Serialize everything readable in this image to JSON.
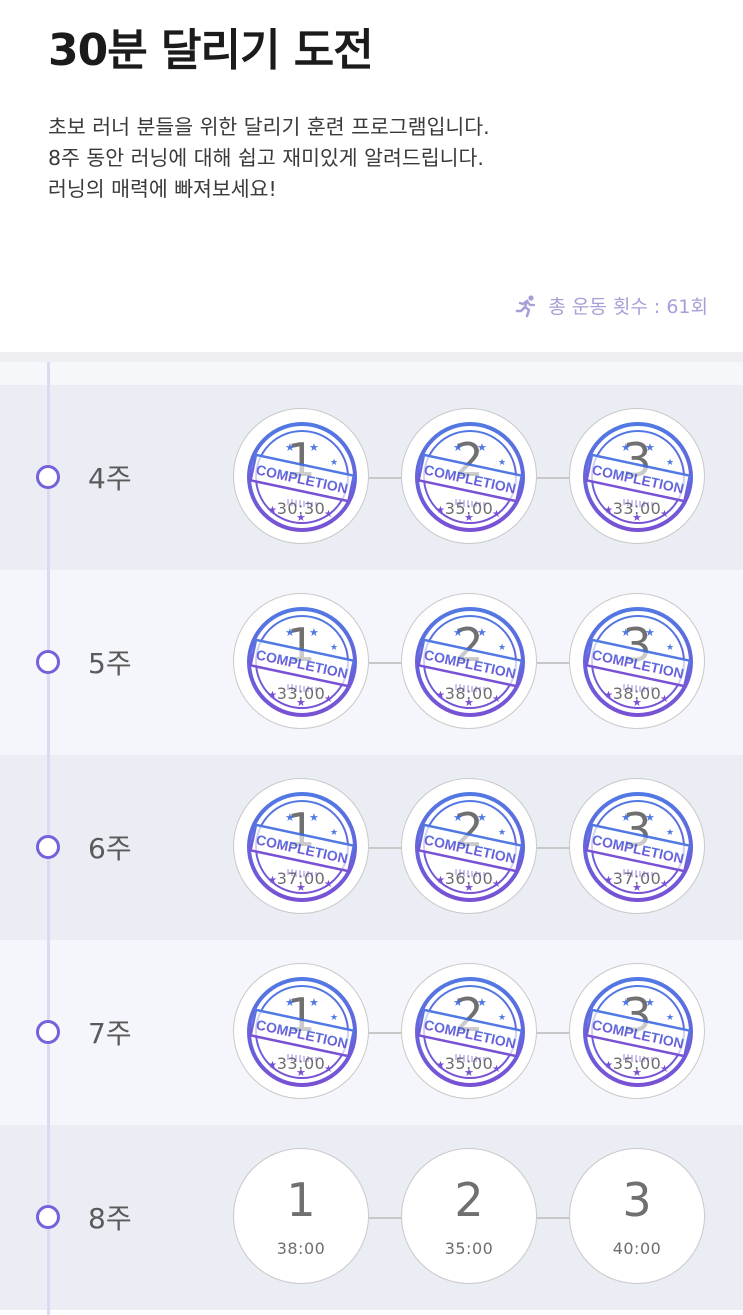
{
  "header": {
    "title": "30분 달리기 도전",
    "description": [
      "초보 러너 분들을 위한 달리기 훈련 프로그램입니다.",
      "8주 동안 러닝에 대해 쉽고 재미있게 알려드립니다.",
      "러닝의 매력에 빠져보세요!"
    ],
    "stats_icon": "running-person-icon",
    "total_workouts": "총 운동 횟수 : 61회"
  },
  "colors": {
    "accent": "#7561d9",
    "stamp_blue": "#3f6be0",
    "stamp_violet": "#6a3fd0"
  },
  "stamp_text": "COMPLETION",
  "weeks": [
    {
      "label": "4주",
      "sessions": [
        {
          "num": "1",
          "time": "30:30",
          "completed": true
        },
        {
          "num": "2",
          "time": "35:00",
          "completed": true
        },
        {
          "num": "3",
          "time": "33:00",
          "completed": true
        }
      ]
    },
    {
      "label": "5주",
      "sessions": [
        {
          "num": "1",
          "time": "33:00",
          "completed": true
        },
        {
          "num": "2",
          "time": "38:00",
          "completed": true
        },
        {
          "num": "3",
          "time": "38:00",
          "completed": true
        }
      ]
    },
    {
      "label": "6주",
      "sessions": [
        {
          "num": "1",
          "time": "37:00",
          "completed": true
        },
        {
          "num": "2",
          "time": "36:00",
          "completed": true
        },
        {
          "num": "3",
          "time": "37:00",
          "completed": true
        }
      ]
    },
    {
      "label": "7주",
      "sessions": [
        {
          "num": "1",
          "time": "33:00",
          "completed": true
        },
        {
          "num": "2",
          "time": "35:00",
          "completed": true
        },
        {
          "num": "3",
          "time": "35:00",
          "completed": true
        }
      ]
    },
    {
      "label": "8주",
      "sessions": [
        {
          "num": "1",
          "time": "38:00",
          "completed": false
        },
        {
          "num": "2",
          "time": "35:00",
          "completed": false
        },
        {
          "num": "3",
          "time": "40:00",
          "completed": false
        }
      ]
    }
  ]
}
